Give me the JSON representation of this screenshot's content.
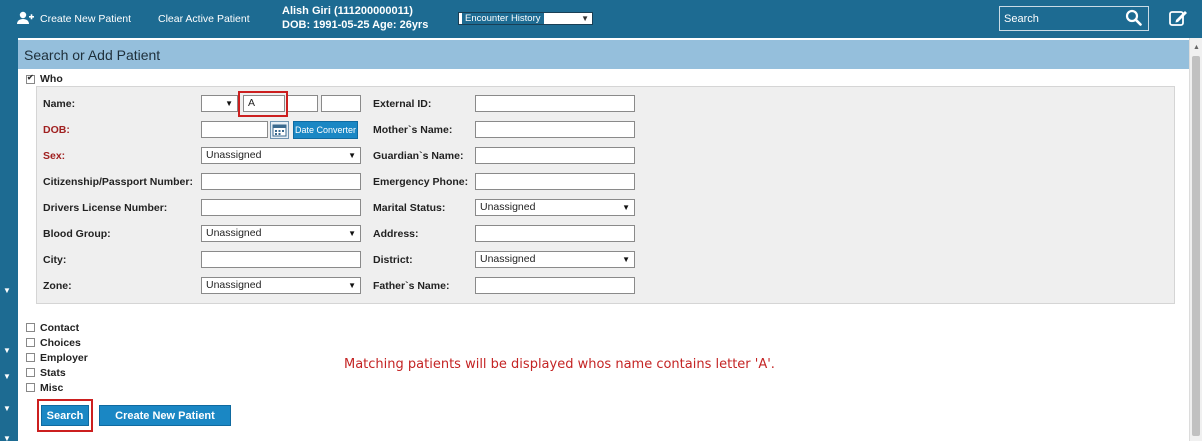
{
  "topbar": {
    "create_label": "Create New Patient",
    "clear_label": "Clear Active Patient",
    "patient_name": "Alish Giri (111200000011)",
    "patient_dob": "DOB: 1991-05-25 Age: 26yrs",
    "encounter_select": "Encounter History",
    "search_label": "Search"
  },
  "panel": {
    "title": "Search or Add Patient"
  },
  "who": {
    "label": "Who",
    "checked": true
  },
  "form": {
    "name_label": "Name:",
    "name_first_value": "A",
    "dob_label": "DOB:",
    "date_converter_label": "Date Converter",
    "sex_label": "Sex:",
    "sex_value": "Unassigned",
    "citizenship_label": "Citizenship/Passport Number:",
    "drivers_label": "Drivers License Number:",
    "blood_label": "Blood Group:",
    "blood_value": "Unassigned",
    "city_label": "City:",
    "zone_label": "Zone:",
    "zone_value": "Unassigned",
    "external_label": "External ID:",
    "mother_label": "Mother`s Name:",
    "guardian_label": "Guardian`s Name:",
    "emergency_label": "Emergency Phone:",
    "marital_label": "Marital Status:",
    "marital_value": "Unassigned",
    "address_label": "Address:",
    "district_label": "District:",
    "district_value": "Unassigned",
    "father_label": "Father`s Name:"
  },
  "sections": [
    "Contact",
    "Choices",
    "Employer",
    "Stats",
    "Misc"
  ],
  "note": "Matching patients will be displayed whos name contains letter 'A'.",
  "buttons": {
    "search": "Search",
    "create": "Create New Patient"
  },
  "colors": {
    "brand": "#1d6b92",
    "header": "#95bfdc",
    "button": "#1a87c4",
    "highlight": "#cc1f1f",
    "note": "#c42424"
  }
}
